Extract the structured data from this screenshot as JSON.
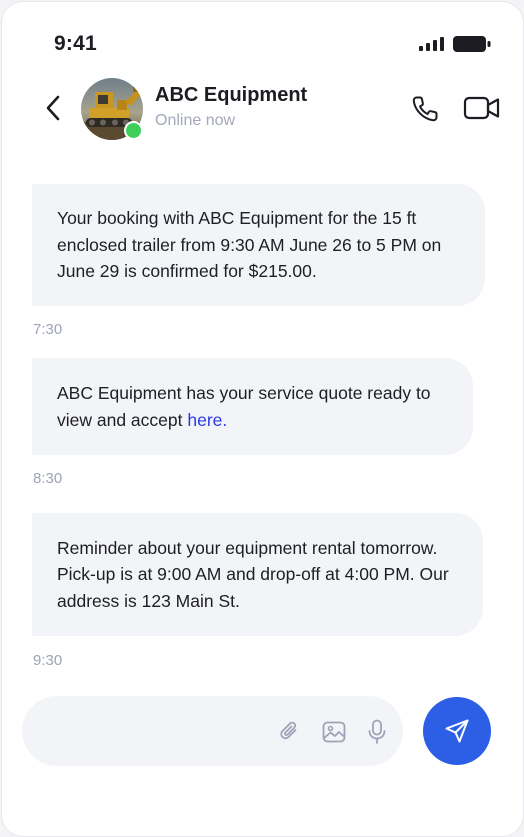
{
  "status_bar": {
    "time": "9:41"
  },
  "header": {
    "contact_name": "ABC Equipment",
    "contact_status": "Online now",
    "icons": [
      "back-arrow-icon",
      "phone-icon",
      "video-camera-icon"
    ]
  },
  "messages": [
    {
      "text": "Your booking with ABC Equipment for the 15 ft enclosed trailer from 9:30 AM June 26 to 5 PM on June 29 is confirmed for $215.00.",
      "time": "7:30"
    },
    {
      "text": "ABC Equipment has your service quote ready to view and accept ",
      "link_text": "here.",
      "time": "8:30"
    },
    {
      "text": "Reminder about your equipment rental tomorrow. Pick-up is at 9:00 AM and drop-off at 4:00 PM. Our address is 123 Main St.",
      "time": "9:30"
    }
  ],
  "composer": {
    "value": "",
    "placeholder": "",
    "icons": [
      "paperclip-icon",
      "image-icon",
      "microphone-icon",
      "send-icon"
    ]
  },
  "colors": {
    "accent": "#2c5fe6",
    "link": "#2b3ae6",
    "online": "#3ecf5a",
    "bubble": "#f3f4f7",
    "muted_text": "#a3a8ba"
  }
}
